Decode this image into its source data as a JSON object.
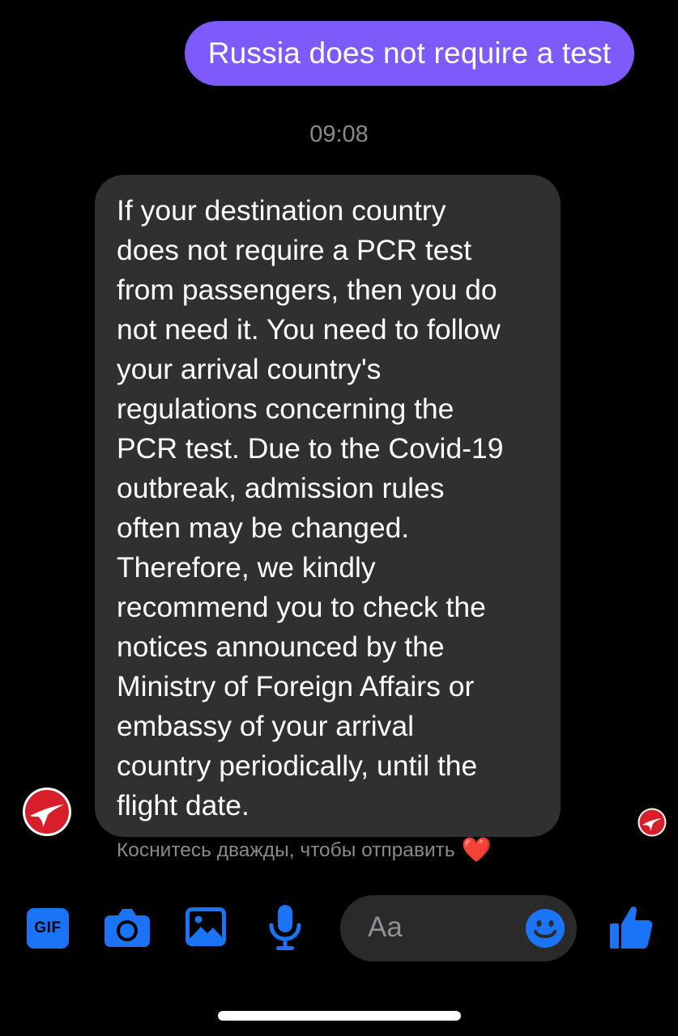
{
  "messages": {
    "sent": {
      "text": "Russia does not require a test"
    },
    "timestamp": "09:08",
    "received": {
      "lines": [
        "If your destination country",
        "does not require a PCR test",
        "from passengers, then you do",
        "not need it. You need to follow",
        "your arrival country's",
        "regulations concerning the",
        "PCR test. Due to the Covid-19",
        "outbreak, admission rules",
        "often may be changed.",
        "Therefore, we kindly",
        "recommend you to check the",
        "notices announced by the",
        "Ministry of Foreign Affairs or",
        "embassy of your arrival",
        "country periodically, until the",
        "flight date."
      ]
    },
    "reaction_hint": {
      "text": "Коснитесь дважды, чтобы отправить",
      "emoji": "❤️"
    }
  },
  "composer": {
    "placeholder": "Aa"
  },
  "toolbar": {
    "gif_label": "GIF",
    "icons": [
      "gif-icon",
      "camera-icon",
      "image-icon",
      "microphone-icon",
      "emoji-icon",
      "thumbs-up-icon"
    ]
  },
  "colors": {
    "sent_bubble": "#7d5bfa",
    "received_bubble": "#303030",
    "accent": "#1b74f5",
    "muted_text": "#8a8a8e",
    "brand_red": "#d81e2a"
  }
}
